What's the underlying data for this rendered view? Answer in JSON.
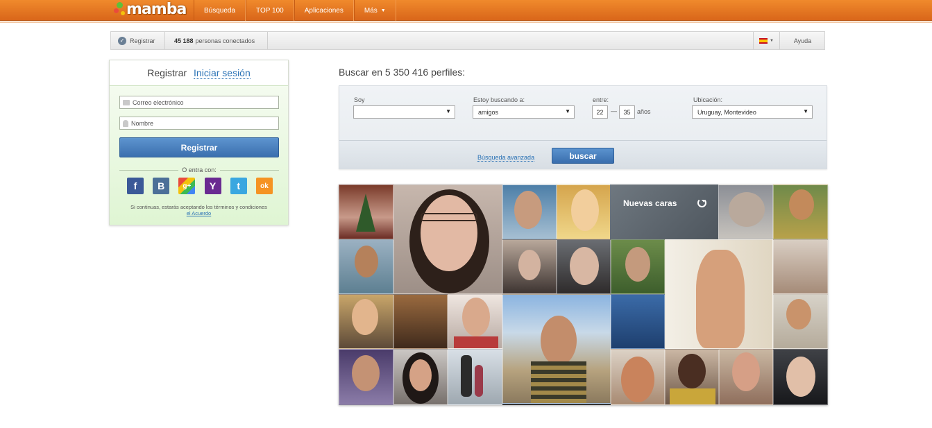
{
  "header": {
    "logo_text": "mamba",
    "nav": [
      {
        "label": "Búsqueda"
      },
      {
        "label": "TOP 100"
      },
      {
        "label": "Aplicaciones"
      },
      {
        "label": "Más"
      }
    ]
  },
  "subbar": {
    "register_label": "Registrar",
    "online_count": "45 188",
    "online_label": "personas conectados",
    "help_label": "Ayuda"
  },
  "auth": {
    "tab_register": "Registrar",
    "tab_login": "Iniciar sesión",
    "email_placeholder": "Correo electrónico",
    "name_placeholder": "Nombre",
    "submit_label": "Registrar",
    "or_label": "O entra con:",
    "social": [
      {
        "icon": "facebook-icon",
        "glyph": "f"
      },
      {
        "icon": "vkontakte-icon",
        "glyph": "B"
      },
      {
        "icon": "google-plus-icon",
        "glyph": "g+"
      },
      {
        "icon": "yahoo-icon",
        "glyph": "Y"
      },
      {
        "icon": "twitter-icon",
        "glyph": "t"
      },
      {
        "icon": "odnoklassniki-icon",
        "glyph": "ok"
      }
    ],
    "terms_text": "Si continuas, estarás aceptando los términos y condiciones",
    "terms_link": "el Acuerdo"
  },
  "search": {
    "title": "Buscar en 5 350 416 perfiles:",
    "soy_label": "Soy",
    "soy_value": "",
    "looking_label": "Estoy buscando a:",
    "looking_value": "amigos",
    "between_label": "entre:",
    "age_from": "22",
    "age_dash": "—",
    "age_to": "35",
    "age_unit": "años",
    "location_label": "Ubicación:",
    "location_value": "Uruguay, Montevideo",
    "advanced_link": "Búsqueda avanzada",
    "search_button": "buscar"
  },
  "photos": {
    "new_faces_label": "Nuevas caras"
  }
}
